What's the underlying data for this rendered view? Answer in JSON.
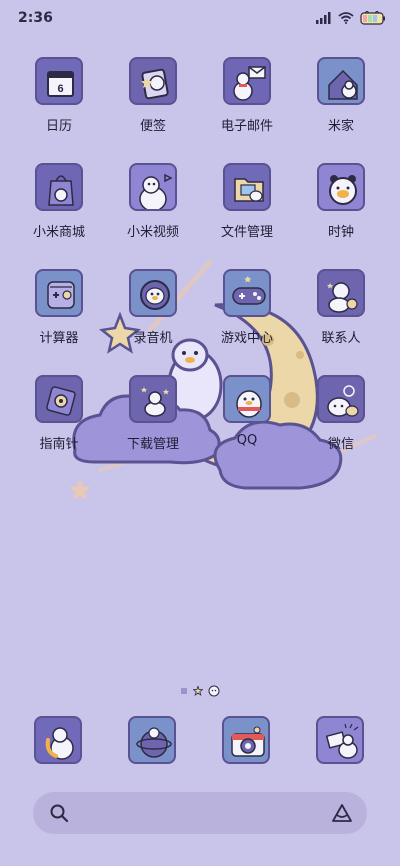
{
  "status_bar": {
    "time": "2:36"
  },
  "apps": [
    {
      "id": "calendar",
      "label": "日历",
      "icon": "calendar-icon",
      "badge_text": "6"
    },
    {
      "id": "notes",
      "label": "便签",
      "icon": "notes-icon"
    },
    {
      "id": "email",
      "label": "电子邮件",
      "icon": "email-icon"
    },
    {
      "id": "mijia",
      "label": "米家",
      "icon": "home-icon"
    },
    {
      "id": "mall",
      "label": "小米商城",
      "icon": "shopping-icon"
    },
    {
      "id": "video",
      "label": "小米视频",
      "icon": "video-icon"
    },
    {
      "id": "files",
      "label": "文件管理",
      "icon": "folder-icon"
    },
    {
      "id": "clock",
      "label": "时钟",
      "icon": "clock-icon"
    },
    {
      "id": "calculator",
      "label": "计算器",
      "icon": "calculator-icon"
    },
    {
      "id": "recorder",
      "label": "录音机",
      "icon": "recorder-icon"
    },
    {
      "id": "games",
      "label": "游戏中心",
      "icon": "gamepad-icon"
    },
    {
      "id": "contacts",
      "label": "联系人",
      "icon": "contacts-icon"
    },
    {
      "id": "compass",
      "label": "指南针",
      "icon": "compass-icon"
    },
    {
      "id": "downloads",
      "label": "下载管理",
      "icon": "download-icon"
    },
    {
      "id": "qq",
      "label": "QQ",
      "icon": "qq-icon"
    },
    {
      "id": "wechat",
      "label": "微信",
      "icon": "wechat-icon"
    }
  ],
  "dock": [
    {
      "id": "phone",
      "icon": "phone-icon"
    },
    {
      "id": "browser",
      "icon": "browser-icon"
    },
    {
      "id": "camera",
      "icon": "camera-icon"
    },
    {
      "id": "messages",
      "icon": "messages-icon"
    }
  ],
  "colors": {
    "background": "#c9c4ea",
    "icon_border": "#5a5291",
    "moon": "#ecd7a8",
    "cloud": "#9d94d9"
  }
}
